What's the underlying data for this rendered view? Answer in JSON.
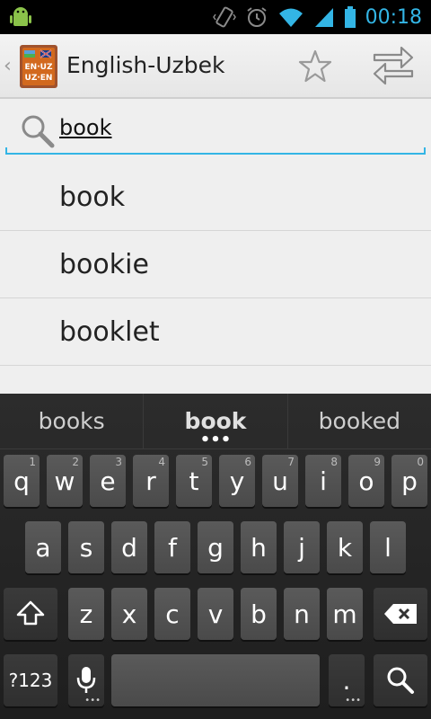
{
  "status_bar": {
    "time": "00:18",
    "icons": [
      "android-debug-icon",
      "vibrate-icon",
      "alarm-icon",
      "wifi-icon",
      "signal-icon",
      "battery-icon"
    ]
  },
  "action_bar": {
    "title": "English-Uzbek",
    "icon_text_top": "EN·UZ",
    "icon_text_bottom": "UZ·EN"
  },
  "search": {
    "value": "book"
  },
  "results": [
    {
      "label": "book"
    },
    {
      "label": "bookie"
    },
    {
      "label": "booklet"
    }
  ],
  "keyboard": {
    "suggestions": [
      "books",
      "book",
      "booked"
    ],
    "row1": [
      {
        "key": "q",
        "hint": "1"
      },
      {
        "key": "w",
        "hint": "2"
      },
      {
        "key": "e",
        "hint": "3"
      },
      {
        "key": "r",
        "hint": "4"
      },
      {
        "key": "t",
        "hint": "5"
      },
      {
        "key": "y",
        "hint": "6"
      },
      {
        "key": "u",
        "hint": "7"
      },
      {
        "key": "i",
        "hint": "8"
      },
      {
        "key": "o",
        "hint": "9"
      },
      {
        "key": "p",
        "hint": "0"
      }
    ],
    "row2": [
      "a",
      "s",
      "d",
      "f",
      "g",
      "h",
      "j",
      "k",
      "l"
    ],
    "row3": [
      "z",
      "x",
      "c",
      "v",
      "b",
      "n",
      "m"
    ],
    "symbols_label": "?123",
    "period_label": "."
  },
  "colors": {
    "accent": "#33b5e5",
    "keyboard_bg": "#222222"
  }
}
